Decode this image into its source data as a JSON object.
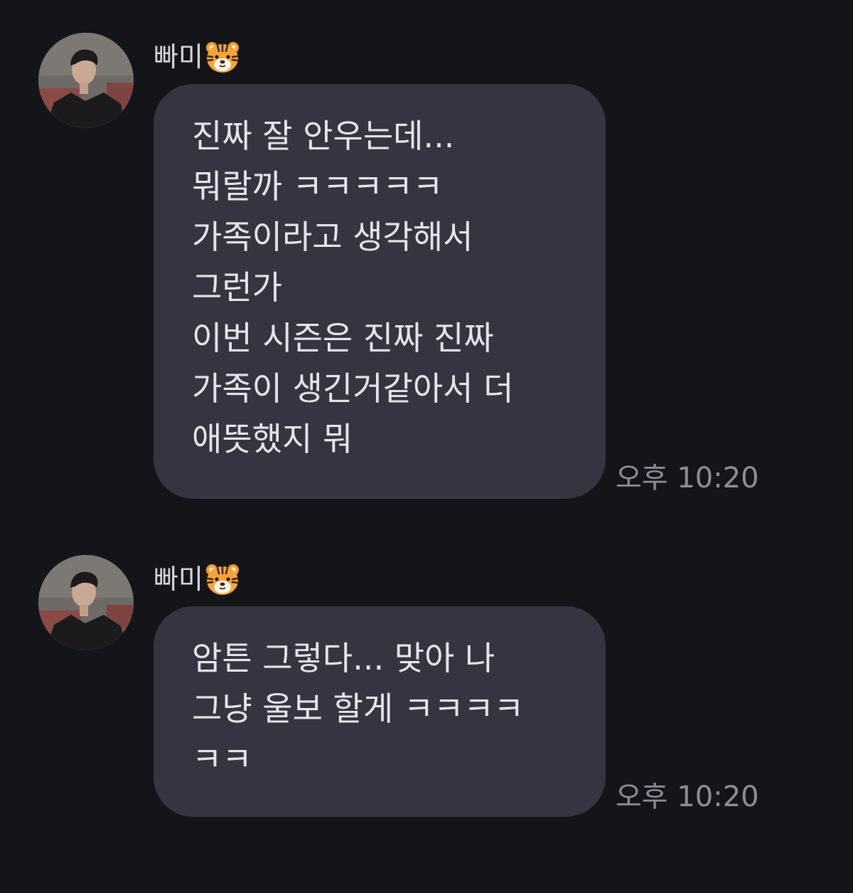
{
  "colors": {
    "background": "#141519",
    "bubble": "#343540",
    "text": "#e4e5ea",
    "timestamp": "#8d8e96"
  },
  "messages": [
    {
      "sender": "빠미",
      "sender_icon": "tiger-face-emoji",
      "avatar": "profile-photo",
      "lines": [
        "진짜 잘 안우는데...",
        "뭐랄까 ㅋㅋㅋㅋㅋ",
        "가족이라고 생각해서",
        "그런가",
        "이번 시즌은 진짜 진짜",
        "가족이 생긴거같아서 더",
        "애뜻했지 뭐"
      ],
      "time": "오후 10:20"
    },
    {
      "sender": "빠미",
      "sender_icon": "tiger-face-emoji",
      "avatar": "profile-photo",
      "lines": [
        "암튼 그렇다... 맞아 나",
        "그냥 울보 할게 ㅋㅋㅋㅋ",
        "ㅋㅋ"
      ],
      "time": "오후 10:20"
    }
  ]
}
